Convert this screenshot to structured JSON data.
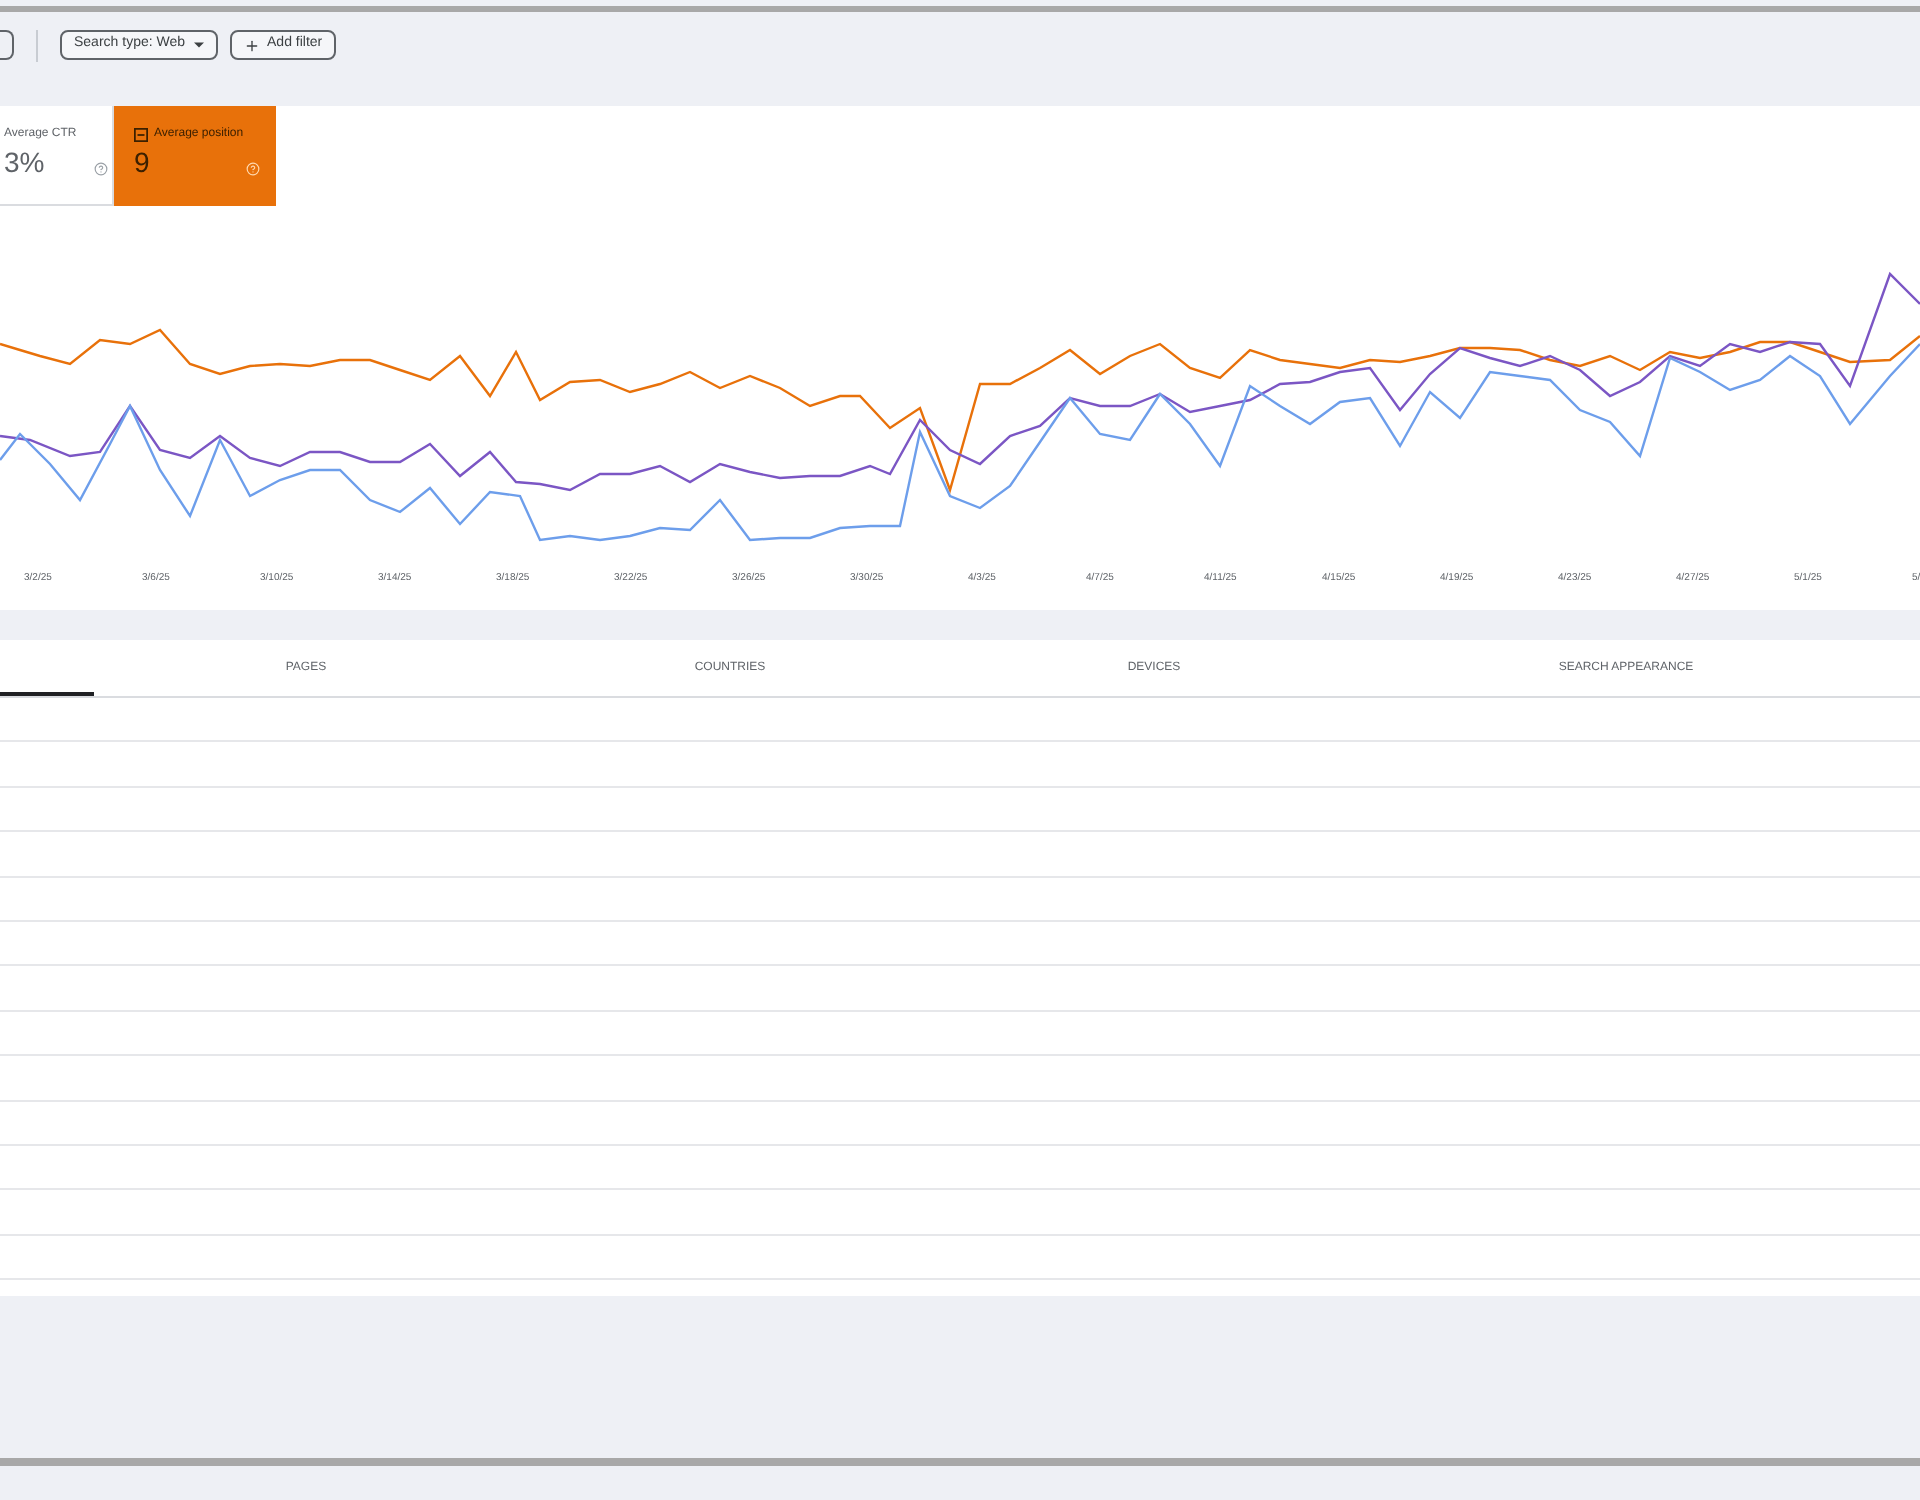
{
  "toolbar": {
    "filters": [
      {
        "kind": "dropdown",
        "label": "Search type: Web"
      },
      {
        "kind": "add",
        "label": "Add filter"
      }
    ]
  },
  "metrics": [
    {
      "label": "Average CTR",
      "value": "3%",
      "selected": false
    },
    {
      "label": "Average position",
      "value": "9",
      "selected": true
    }
  ],
  "chart": {
    "x_labels": [
      "3/2/25",
      "3/6/25",
      "3/10/25",
      "3/14/25",
      "3/18/25",
      "3/22/25",
      "3/26/25",
      "3/30/25",
      "4/3/25",
      "4/7/25",
      "4/11/25",
      "4/15/25",
      "4/19/25",
      "4/23/25",
      "4/27/25",
      "5/1/25",
      "5/"
    ]
  },
  "tabs": [
    {
      "selected": true
    },
    {
      "label": "PAGES",
      "selected": false
    },
    {
      "label": "COUNTRIES",
      "selected": false
    },
    {
      "label": "DEVICES",
      "selected": false
    },
    {
      "label": "SEARCH APPEARANCE",
      "selected": false
    }
  ]
}
